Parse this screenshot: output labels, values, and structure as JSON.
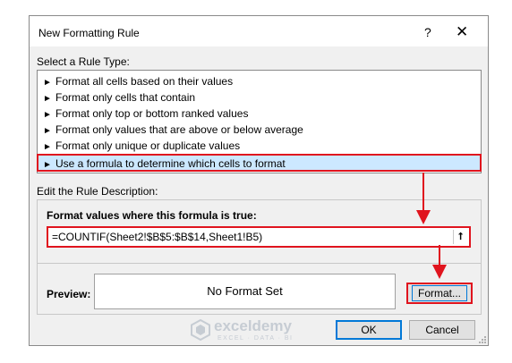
{
  "window": {
    "title": "New Formatting Rule",
    "help_glyph": "?",
    "close_glyph": "✕"
  },
  "rule_type": {
    "label": "Select a Rule Type:",
    "items": [
      "Format all cells based on their values",
      "Format only cells that contain",
      "Format only top or bottom ranked values",
      "Format only values that are above or below average",
      "Format only unique or duplicate values",
      "Use a formula to determine which cells to format"
    ],
    "selected_index": 5
  },
  "description": {
    "label": "Edit the Rule Description:",
    "formula_label": "Format values where this formula is true:",
    "formula_value": "=COUNTIF(Sheet2!$B$5:$B$14,Sheet1!B5)",
    "collapse_glyph": "⭡"
  },
  "preview": {
    "label": "Preview:",
    "text": "No Format Set"
  },
  "buttons": {
    "format": "Format...",
    "ok": "OK",
    "cancel": "Cancel"
  },
  "watermark": {
    "name": "exceldemy",
    "tagline": "EXCEL · DATA · BI"
  },
  "icons": {
    "rule_bullet": "play-arrow-icon",
    "collapse": "collapse-dialog-icon"
  },
  "colors": {
    "highlight_red": "#e0141e",
    "selection_blue": "#cce8ff",
    "focus_blue": "#0078d7",
    "dialog_bg": "#f0f0f0"
  }
}
